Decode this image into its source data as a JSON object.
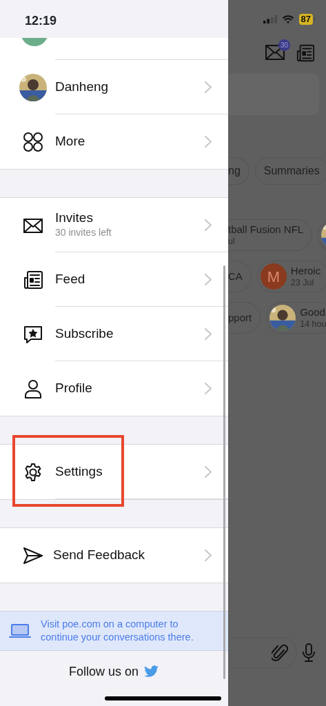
{
  "status_bar": {
    "time": "12:19",
    "battery": "87"
  },
  "drawer": {
    "cut_row": {
      "avatar": {
        "kind": "picture"
      }
    },
    "sections": [
      {
        "items": [
          {
            "kind": "avatar",
            "label": "Danheng"
          },
          {
            "kind": "more",
            "label": "More"
          }
        ]
      },
      {
        "items": [
          {
            "kind": "mail",
            "label": "Invites",
            "sublabel": "30 invites left"
          },
          {
            "kind": "feed",
            "label": "Feed"
          },
          {
            "kind": "subscribe",
            "label": "Subscribe"
          },
          {
            "kind": "profile",
            "label": "Profile"
          }
        ]
      },
      {
        "items": [
          {
            "kind": "settings",
            "label": "Settings",
            "highlighted": true
          }
        ]
      },
      {
        "items": [
          {
            "kind": "send",
            "label": "Send Feedback"
          }
        ]
      }
    ],
    "banner": "Visit poe.com on a computer to continue your conversations there.",
    "follow": "Follow us on"
  },
  "background": {
    "inbox_badge": "30",
    "chips": [
      {
        "label": "ng",
        "cut": true
      },
      {
        "label": "Summaries",
        "cut": false
      }
    ],
    "bot_rows": [
      [
        {
          "name": "tball Fusion NFL",
          "sub": "ul",
          "cut": true
        },
        {
          "kind": "picture",
          "cut_right": true
        }
      ],
      [
        {
          "name": "CA",
          "cut": true
        },
        {
          "kind": "letter",
          "letter": "M",
          "name": "Heroic",
          "sub": "23 Jul"
        }
      ],
      [
        {
          "name": "pport",
          "cut": true
        },
        {
          "kind": "picture",
          "name": "Good",
          "sub": "14 hou"
        }
      ]
    ]
  }
}
